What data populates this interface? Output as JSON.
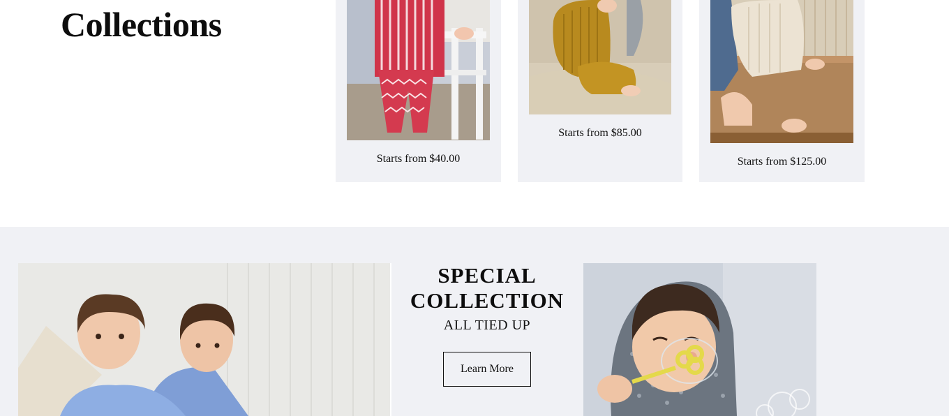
{
  "collections": {
    "title": "Collections",
    "cards": [
      {
        "price": "Starts from $40.00",
        "icon": "child-red-pattern-outfit-photo"
      },
      {
        "price": "Starts from $85.00",
        "icon": "child-mustard-knit-outfit-photo"
      },
      {
        "price": "Starts from $125.00",
        "icon": "child-cream-cardigan-photo"
      }
    ]
  },
  "special": {
    "title_line1": "SPECIAL",
    "title_line2": "COLLECTION",
    "subtitle": "ALL TIED UP",
    "button_label": "Learn More"
  },
  "colors": {
    "card_bg": "#f0f1f5",
    "section_bg": "#f0f1f5",
    "text": "#111111"
  }
}
